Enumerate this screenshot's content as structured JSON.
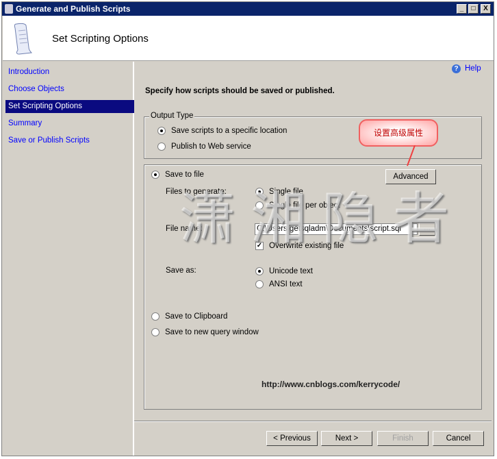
{
  "window": {
    "title": "Generate and Publish Scripts",
    "controls": [
      "_",
      "□",
      "X"
    ]
  },
  "header": {
    "title": "Set Scripting Options",
    "icon": "script-scroll-icon"
  },
  "sidebar": {
    "items": [
      {
        "label": "Introduction",
        "selected": false
      },
      {
        "label": "Choose Objects",
        "selected": false
      },
      {
        "label": "Set Scripting Options",
        "selected": true
      },
      {
        "label": "Summary",
        "selected": false
      },
      {
        "label": "Save or Publish Scripts",
        "selected": false
      }
    ]
  },
  "help": {
    "label": "Help",
    "icon": "help-icon"
  },
  "main": {
    "instruction": "Specify how scripts should be saved or published.",
    "output_type": {
      "legend": "Output Type",
      "options": [
        {
          "label": "Save scripts to a specific location",
          "checked": true
        },
        {
          "label": "Publish to Web service",
          "checked": false
        }
      ]
    },
    "save_to_file": {
      "label": "Save to file",
      "checked": true
    },
    "advanced_button": "Advanced",
    "files_to_generate": {
      "label": "Files to generate:",
      "options": [
        {
          "label": "Single file",
          "checked": true
        },
        {
          "label": "Single file per object",
          "checked": false
        }
      ]
    },
    "file_name": {
      "label": "File name:",
      "value": "C:\\Users\\getsqladm\\Documents\\script.sql",
      "browse": "..."
    },
    "overwrite": {
      "label": "Overwrite existing file",
      "checked": true
    },
    "save_as": {
      "label": "Save as:",
      "options": [
        {
          "label": "Unicode text",
          "checked": true
        },
        {
          "label": "ANSI text",
          "checked": false
        }
      ]
    },
    "clipboard": {
      "label": "Save to Clipboard",
      "checked": false
    },
    "query_window": {
      "label": "Save to new query window",
      "checked": false
    }
  },
  "annotation": {
    "callout": "设置高级属性",
    "watermark": "潇湘隐者",
    "url": "http://www.cnblogs.com/kerrycode/",
    "accent": "#f06060"
  },
  "footer": {
    "previous": "< Previous",
    "next": "Next >",
    "finish": "Finish",
    "cancel": "Cancel"
  }
}
